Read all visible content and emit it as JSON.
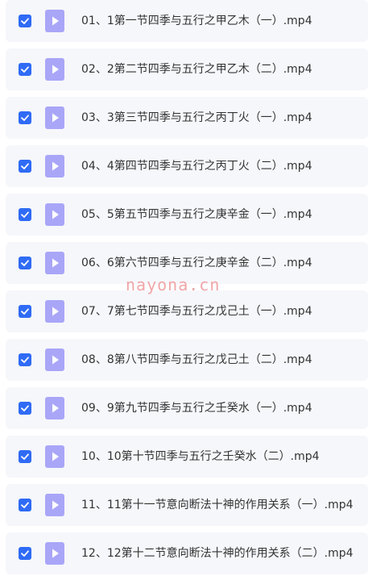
{
  "file_icon": "video-file-icon",
  "checkbox_icon": "checkmark-icon",
  "colors": {
    "checkbox": "#2f6bf5",
    "file_icon": "#a9a6f8",
    "row_background": "#f6f7fb",
    "text": "#333333",
    "watermark": "#f0a6a8"
  },
  "files": [
    {
      "name": "01、1第一节四季与五行之甲乙木（一）.mp4",
      "checked": true
    },
    {
      "name": "02、2第二节四季与五行之甲乙木（二）.mp4",
      "checked": true
    },
    {
      "name": "03、3第三节四季与五行之丙丁火（一）.mp4",
      "checked": true
    },
    {
      "name": "04、4第四节四季与五行之丙丁火（二）.mp4",
      "checked": true
    },
    {
      "name": "05、5第五节四季与五行之庚辛金（一）.mp4",
      "checked": true
    },
    {
      "name": "06、6第六节四季与五行之庚辛金（二）.mp4",
      "checked": true
    },
    {
      "name": "07、7第七节四季与五行之戊己土（一）.mp4",
      "checked": true
    },
    {
      "name": "08、8第八节四季与五行之戊己土（二）.mp4",
      "checked": true
    },
    {
      "name": "09、9第九节四季与五行之壬癸水（一）.mp4",
      "checked": true
    },
    {
      "name": "10、10第十节四季与五行之壬癸水（二）.mp4",
      "checked": true
    },
    {
      "name": "11、11第十一节意向断法十神的作用关系（一）.mp4",
      "checked": true
    },
    {
      "name": "12、12第十二节意向断法十神的作用关系（二）.mp4",
      "checked": true
    }
  ],
  "watermark": "nayona.cn"
}
